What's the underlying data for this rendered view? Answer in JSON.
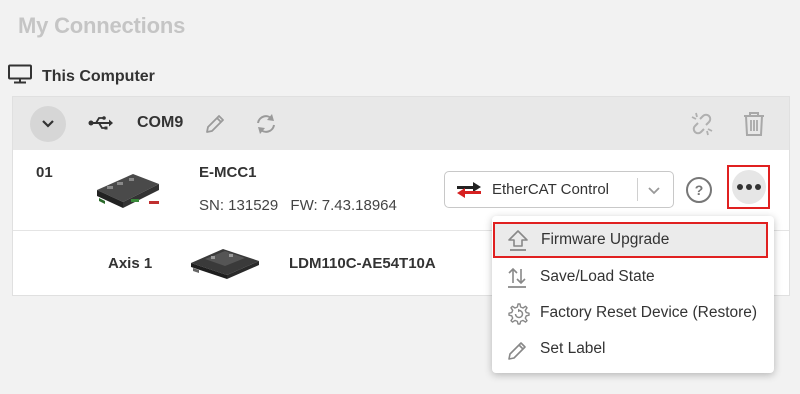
{
  "page": {
    "title": "My Connections"
  },
  "computer": {
    "label": "This Computer",
    "icon": "monitor-icon"
  },
  "port": {
    "name": "COM9",
    "icons": [
      "chevron-down-icon",
      "usb-icon",
      "pencil-icon",
      "sync-icon",
      "unlink-icon",
      "trash-icon"
    ]
  },
  "device": {
    "index": "01",
    "name": "E-MCC1",
    "sn": "SN: 131529",
    "fw": "FW: 7.43.18964",
    "mode": {
      "label": "EtherCAT Control",
      "icon": "ethercat-icon"
    },
    "help_label": "?"
  },
  "axis": {
    "label": "Axis 1",
    "model": "LDM110C-AE54T10A"
  },
  "menu": {
    "items": [
      {
        "label": "Firmware Upgrade",
        "icon": "upload-icon",
        "highlighted": true
      },
      {
        "label": "Save/Load State",
        "icon": "save-load-icon"
      },
      {
        "label": "Factory Reset Device (Restore)",
        "icon": "gear-reset-icon"
      },
      {
        "label": "Set Label",
        "icon": "pencil-icon"
      }
    ]
  },
  "colors": {
    "background": "#f2f2f2",
    "header": "#e8e8e8",
    "highlight_border": "#e02020",
    "title_gray": "#c5c5c5"
  }
}
